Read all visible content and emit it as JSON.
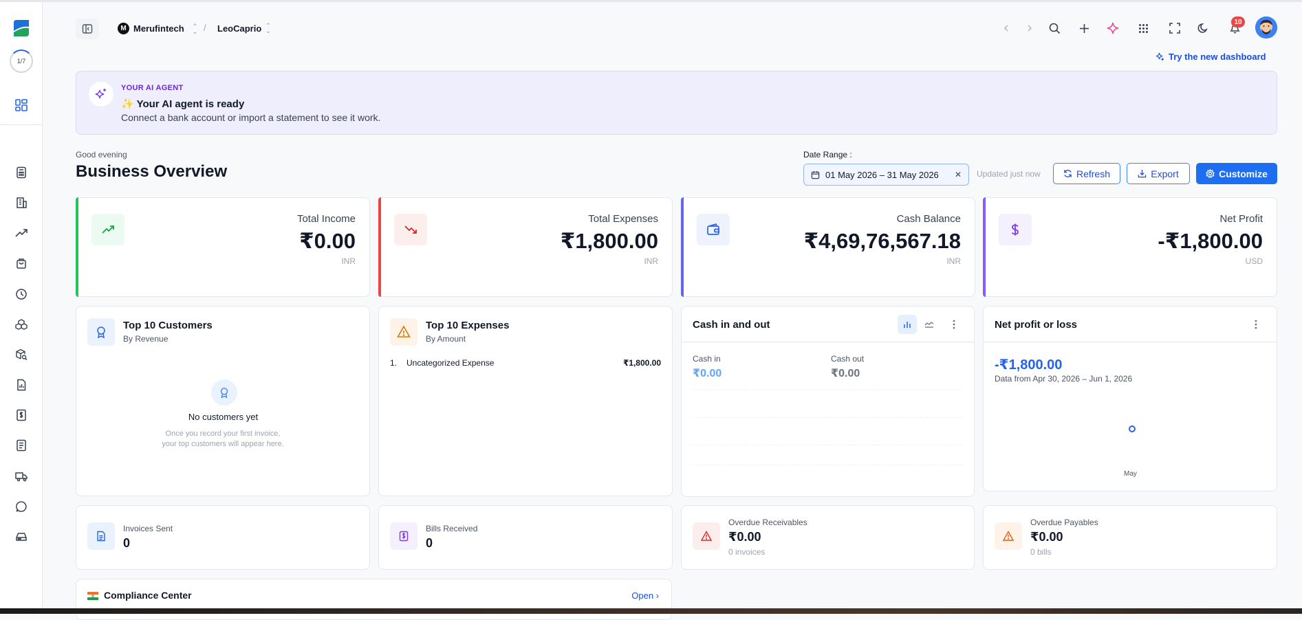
{
  "sidebar": {
    "progress": "1/7"
  },
  "header": {
    "org_initial": "M",
    "org_name": "Merufintech",
    "project": "LeoCaprio",
    "separator": "/",
    "notifications": "10",
    "try_new": "Try the new dashboard"
  },
  "ai_banner": {
    "kicker": "YOUR AI AGENT",
    "title": "✨ Your AI agent is ready",
    "subtitle": "Connect a bank account or import a statement to see it work."
  },
  "overview": {
    "greeting": "Good evening",
    "title": "Business Overview",
    "date_range_label": "Date Range :",
    "date_range": "01 May 2026 – 31 May 2026",
    "updated": "Updated just now",
    "refresh": "Refresh",
    "export": "Export",
    "customize": "Customize"
  },
  "kpis": [
    {
      "label": "Total Income",
      "value": "₹0.00",
      "currency": "INR",
      "accent": "#22c55e"
    },
    {
      "label": "Total Expenses",
      "value": "₹1,800.00",
      "currency": "INR",
      "accent": "#ef4444"
    },
    {
      "label": "Cash Balance",
      "value": "₹4,69,76,567.18",
      "currency": "INR",
      "accent": "#6366f1"
    },
    {
      "label": "Net Profit",
      "value": "-₹1,800.00",
      "currency": "USD",
      "accent": "#8b5cf6"
    }
  ],
  "top_customers": {
    "title": "Top 10 Customers",
    "subtitle": "By Revenue",
    "empty_title": "No customers yet",
    "empty_sub": "Once you record your first invoice, your top customers will appear here."
  },
  "top_expenses": {
    "title": "Top 10 Expenses",
    "subtitle": "By Amount",
    "items": [
      {
        "rank": "1.",
        "name": "Uncategorized Expense",
        "amount": "₹1,800.00"
      }
    ]
  },
  "cash_in_out": {
    "title": "Cash in and out",
    "cash_in_label": "Cash in",
    "cash_in_value": "₹0.00",
    "cash_out_label": "Cash out",
    "cash_out_value": "₹0.00"
  },
  "net_profit_loss": {
    "title": "Net profit or loss",
    "value": "-₹1,800.00",
    "subtitle": "Data from Apr 30, 2026 – Jun 1, 2026",
    "month": "May"
  },
  "chart_data": {
    "type": "line",
    "categories": [
      "May"
    ],
    "values": [
      -1800
    ]
  },
  "bottom_cards": [
    {
      "label": "Invoices Sent",
      "value": "0"
    },
    {
      "label": "Bills Received",
      "value": "0"
    },
    {
      "label": "Overdue Receivables",
      "value": "₹0.00",
      "sub": "0 invoices"
    },
    {
      "label": "Overdue Payables",
      "value": "₹0.00",
      "sub": "0 bills"
    }
  ],
  "compliance": {
    "title": "Compliance Center",
    "open": "Open ›"
  }
}
